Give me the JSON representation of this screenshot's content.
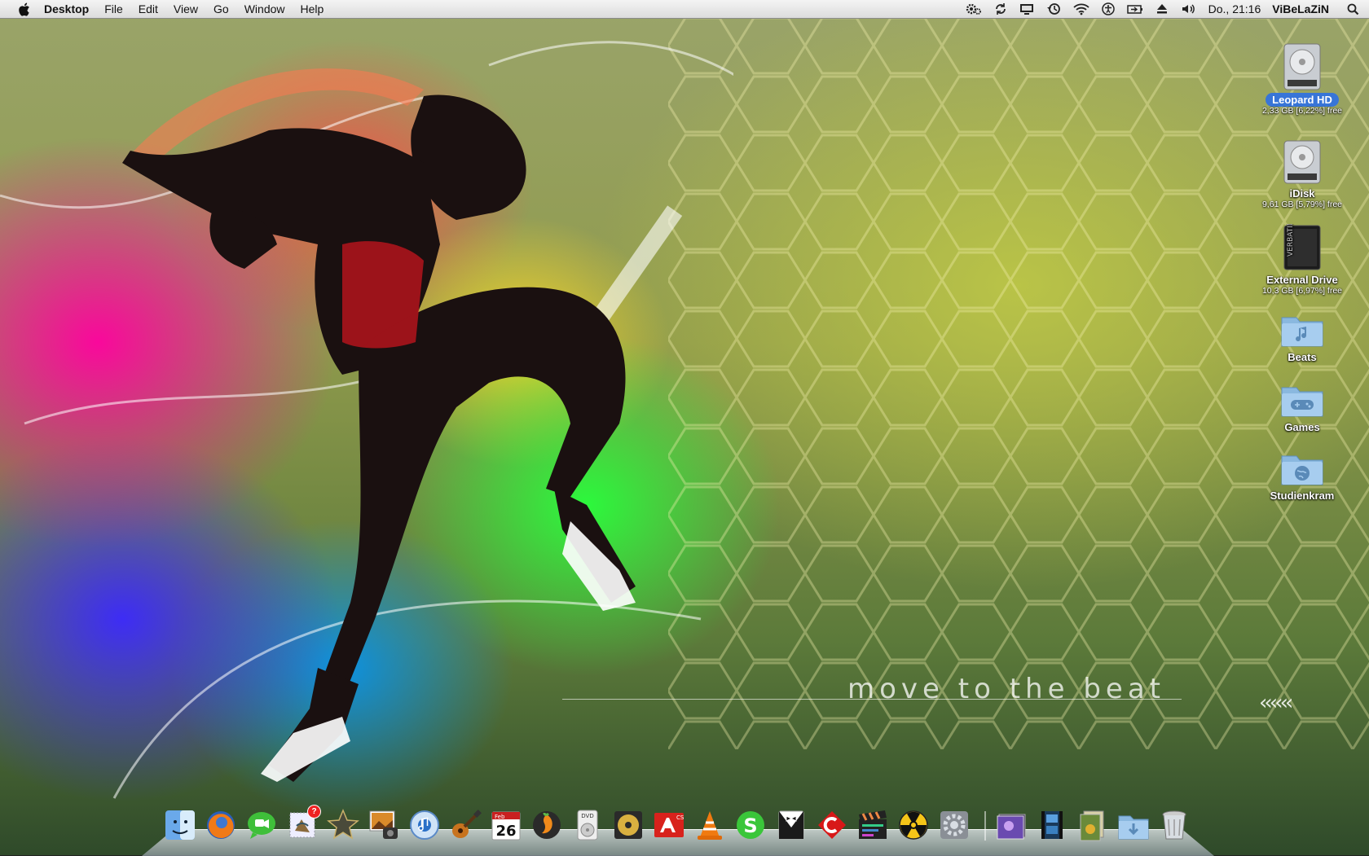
{
  "menubar": {
    "app_name": "Desktop",
    "menus": [
      "File",
      "Edit",
      "View",
      "Go",
      "Window",
      "Help"
    ],
    "status_icons": [
      "gears-icon",
      "sync-icon",
      "display-icon",
      "time-machine-icon",
      "wifi-icon",
      "accessibility-icon",
      "battery-icon",
      "eject-icon",
      "volume-icon"
    ],
    "clock": "Do., 21:16",
    "user": "ViBeLaZiN"
  },
  "wallpaper": {
    "tagline": "move to the beat",
    "chevrons": "‹‹‹‹‹‹"
  },
  "desktop_icons": [
    {
      "name": "Leopard HD",
      "sub": "2,33 GB [6,22%] free",
      "kind": "hard-drive",
      "selected": true
    },
    {
      "name": "iDisk",
      "sub": "9,61 GB [5,79%] free",
      "kind": "hard-drive",
      "selected": false
    },
    {
      "name": "External Drive",
      "sub": "10,3 GB [6,97%] free",
      "kind": "external-drive",
      "selected": false
    },
    {
      "name": "Beats",
      "sub": "",
      "kind": "music-folder",
      "selected": false
    },
    {
      "name": "Games",
      "sub": "",
      "kind": "games-folder",
      "selected": false
    },
    {
      "name": "Studienkram",
      "sub": "",
      "kind": "globe-folder",
      "selected": false
    }
  ],
  "dock": {
    "apps": [
      "finder",
      "firefox",
      "facetime",
      "mail",
      "imovie",
      "iphoto",
      "itunes",
      "garageband",
      "ical",
      "fl-studio",
      "dvd-player",
      "disk-utility",
      "adobe-cs",
      "vlc",
      "skype",
      "tuxedo",
      "cinema",
      "final-cut",
      "burn",
      "system-preferences"
    ],
    "ical_date": "26",
    "ical_month": "Feb",
    "mail_badge": "?",
    "stacks": [
      "photos-stack",
      "movies-stack",
      "documents-stack",
      "downloads-stack",
      "trash"
    ]
  }
}
